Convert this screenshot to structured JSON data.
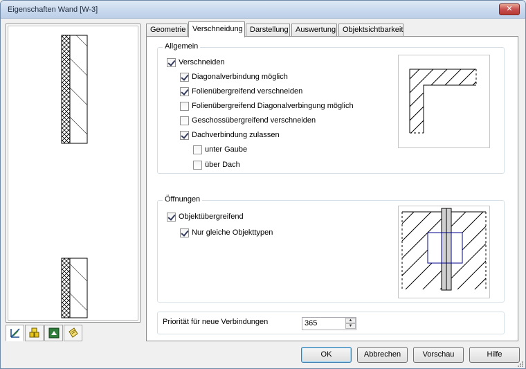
{
  "window": {
    "title": "Eigenschaften Wand [W-3]",
    "close_symbol": "✕"
  },
  "tabs": [
    {
      "label": "Geometrie"
    },
    {
      "label": "Verschneidung"
    },
    {
      "label": "Darstellung"
    },
    {
      "label": "Auswertung"
    },
    {
      "label": "Objektsichtbarkeit"
    }
  ],
  "active_tab": "Verschneidung",
  "groups": {
    "allgemein": {
      "title": "Allgemein",
      "options": [
        {
          "label": "Verschneiden",
          "checked": true
        },
        {
          "label": "Diagonalverbindung möglich",
          "checked": true
        },
        {
          "label": "Folienübergreifend verschneiden",
          "checked": true
        },
        {
          "label": "Folienübergreifend Diagonalverbingung möglich",
          "checked": false
        },
        {
          "label": "Geschossübergreifend verschneiden",
          "checked": false
        },
        {
          "label": "Dachverbindung zulassen",
          "checked": true
        },
        {
          "label": "unter Gaube",
          "checked": false
        },
        {
          "label": "über Dach",
          "checked": false
        }
      ]
    },
    "oeffnungen": {
      "title": "Öffnungen",
      "options": [
        {
          "label": "Objektübergreifend",
          "checked": true
        },
        {
          "label": "Nur gleiche Objekttypen",
          "checked": true
        }
      ]
    },
    "prioritaet": {
      "label": "Priorität für neue Verbindungen",
      "value": "365"
    }
  },
  "left_icons": [
    "wall-geometry-icon",
    "materials-icon",
    "display-icon",
    "notes-icon"
  ],
  "buttons": {
    "ok": "OK",
    "cancel": "Abbrechen",
    "preview": "Vorschau",
    "help": "Hilfe"
  },
  "colors": {
    "accent": "#3c7fb1",
    "title_close": "#c75050",
    "opening": "#00008b"
  }
}
